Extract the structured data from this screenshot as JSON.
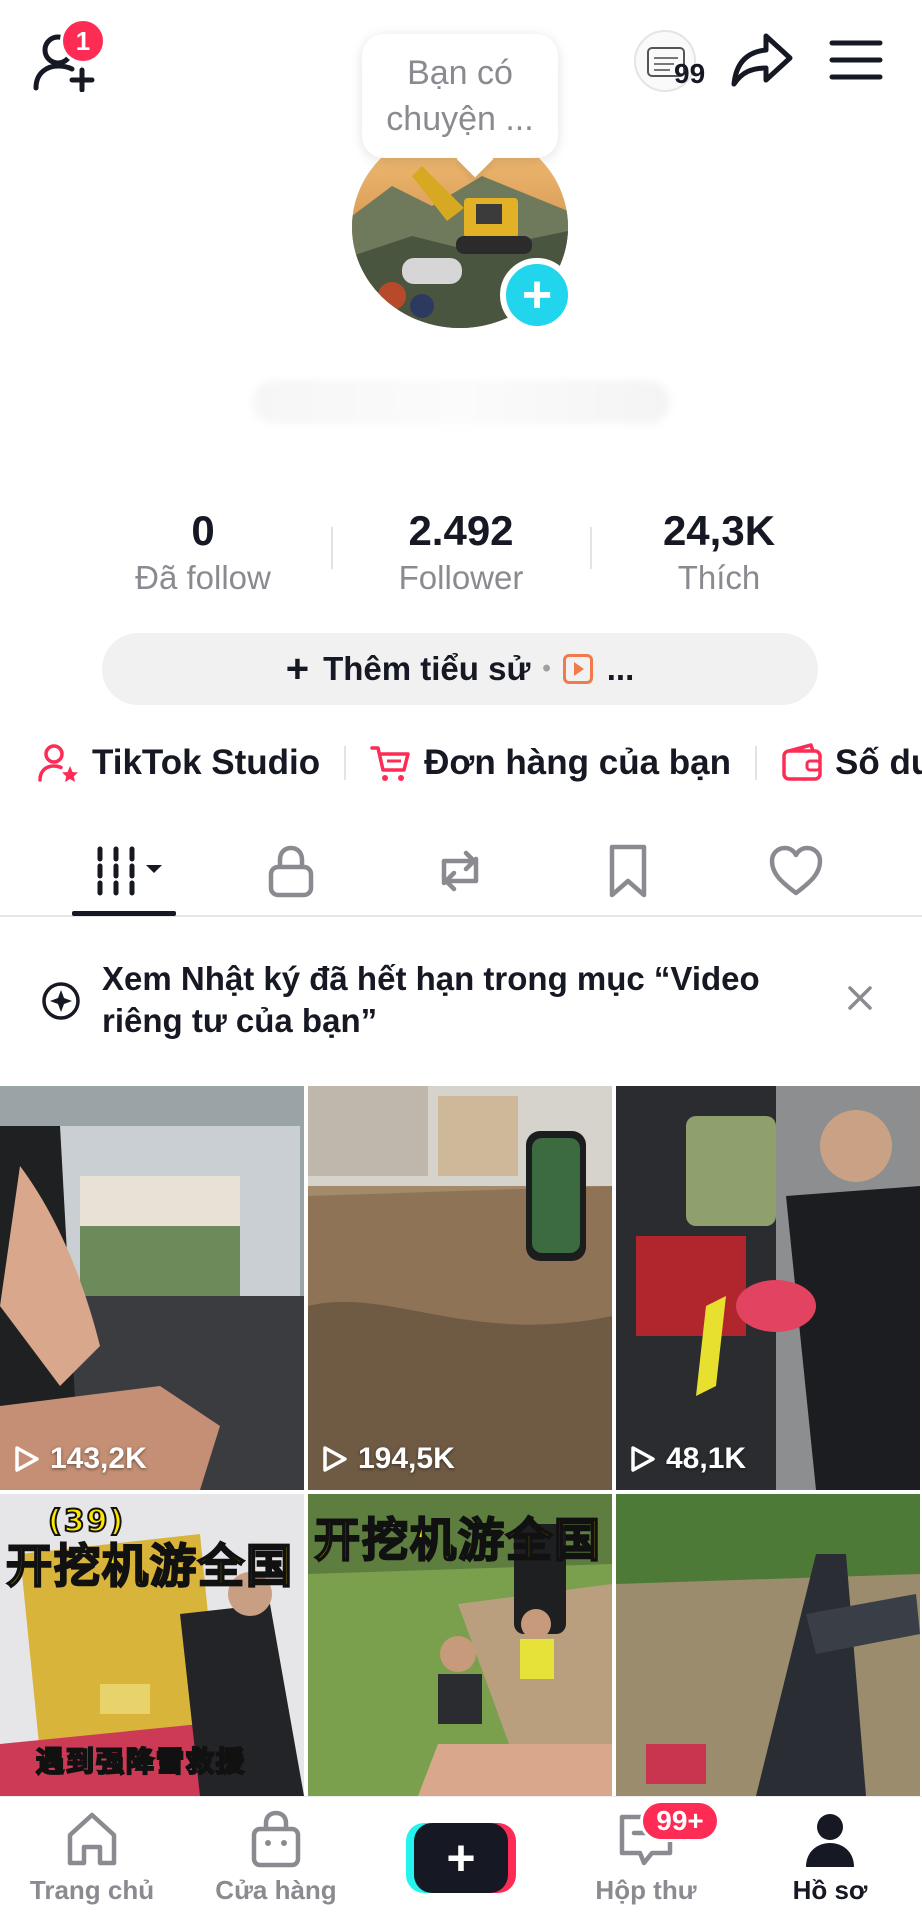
{
  "header": {
    "notification_count": "1",
    "story_count": "99",
    "bubble_text": "Bạn có chuyện ..."
  },
  "stats": [
    {
      "value": "0",
      "label": "Đã follow"
    },
    {
      "value": "2.492",
      "label": "Follower"
    },
    {
      "value": "24,3K",
      "label": "Thích"
    }
  ],
  "bio_button": {
    "label": "Thêm tiểu sử",
    "more": "..."
  },
  "shortcuts": [
    {
      "label": "TikTok Studio",
      "icon": "person-star-icon"
    },
    {
      "label": "Đơn hàng của bạn",
      "icon": "cart-icon"
    },
    {
      "label": "Số dư",
      "icon": "wallet-icon"
    }
  ],
  "tabs": [
    {
      "name": "videos",
      "icon": "grid-icon"
    },
    {
      "name": "private",
      "icon": "lock-icon"
    },
    {
      "name": "reposts",
      "icon": "repost-icon"
    },
    {
      "name": "favorites",
      "icon": "bookmark-icon"
    },
    {
      "name": "liked",
      "icon": "heart-icon"
    }
  ],
  "banner": {
    "text": "Xem Nhật ký đã hết hạn trong mục “Video riêng tư của bạn”"
  },
  "videos": [
    {
      "views": "143,2K"
    },
    {
      "views": "194,5K"
    },
    {
      "views": "48,1K"
    },
    {
      "views": "",
      "overlay_text": "开挖机游全国",
      "episode": "(39)",
      "sub_text": "遇到强降雪救援"
    },
    {
      "views": "",
      "overlay_text": "开挖机游全国"
    },
    {
      "views": ""
    }
  ],
  "bottom_nav": {
    "items": [
      {
        "label": "Trang chủ",
        "icon": "home-icon"
      },
      {
        "label": "Cửa hàng",
        "icon": "shop-bag-icon"
      },
      {
        "label": "",
        "icon": "create-plus-icon"
      },
      {
        "label": "Hộp thư",
        "icon": "inbox-icon"
      },
      {
        "label": "Hồ sơ",
        "icon": "profile-icon"
      }
    ],
    "inbox_badge": "99+"
  },
  "colors": {
    "accent_red": "#fe2c55",
    "accent_cyan": "#25f4ee",
    "avatar_plus": "#20d5ec",
    "text_primary": "#161823",
    "text_secondary": "#8a8b91"
  }
}
